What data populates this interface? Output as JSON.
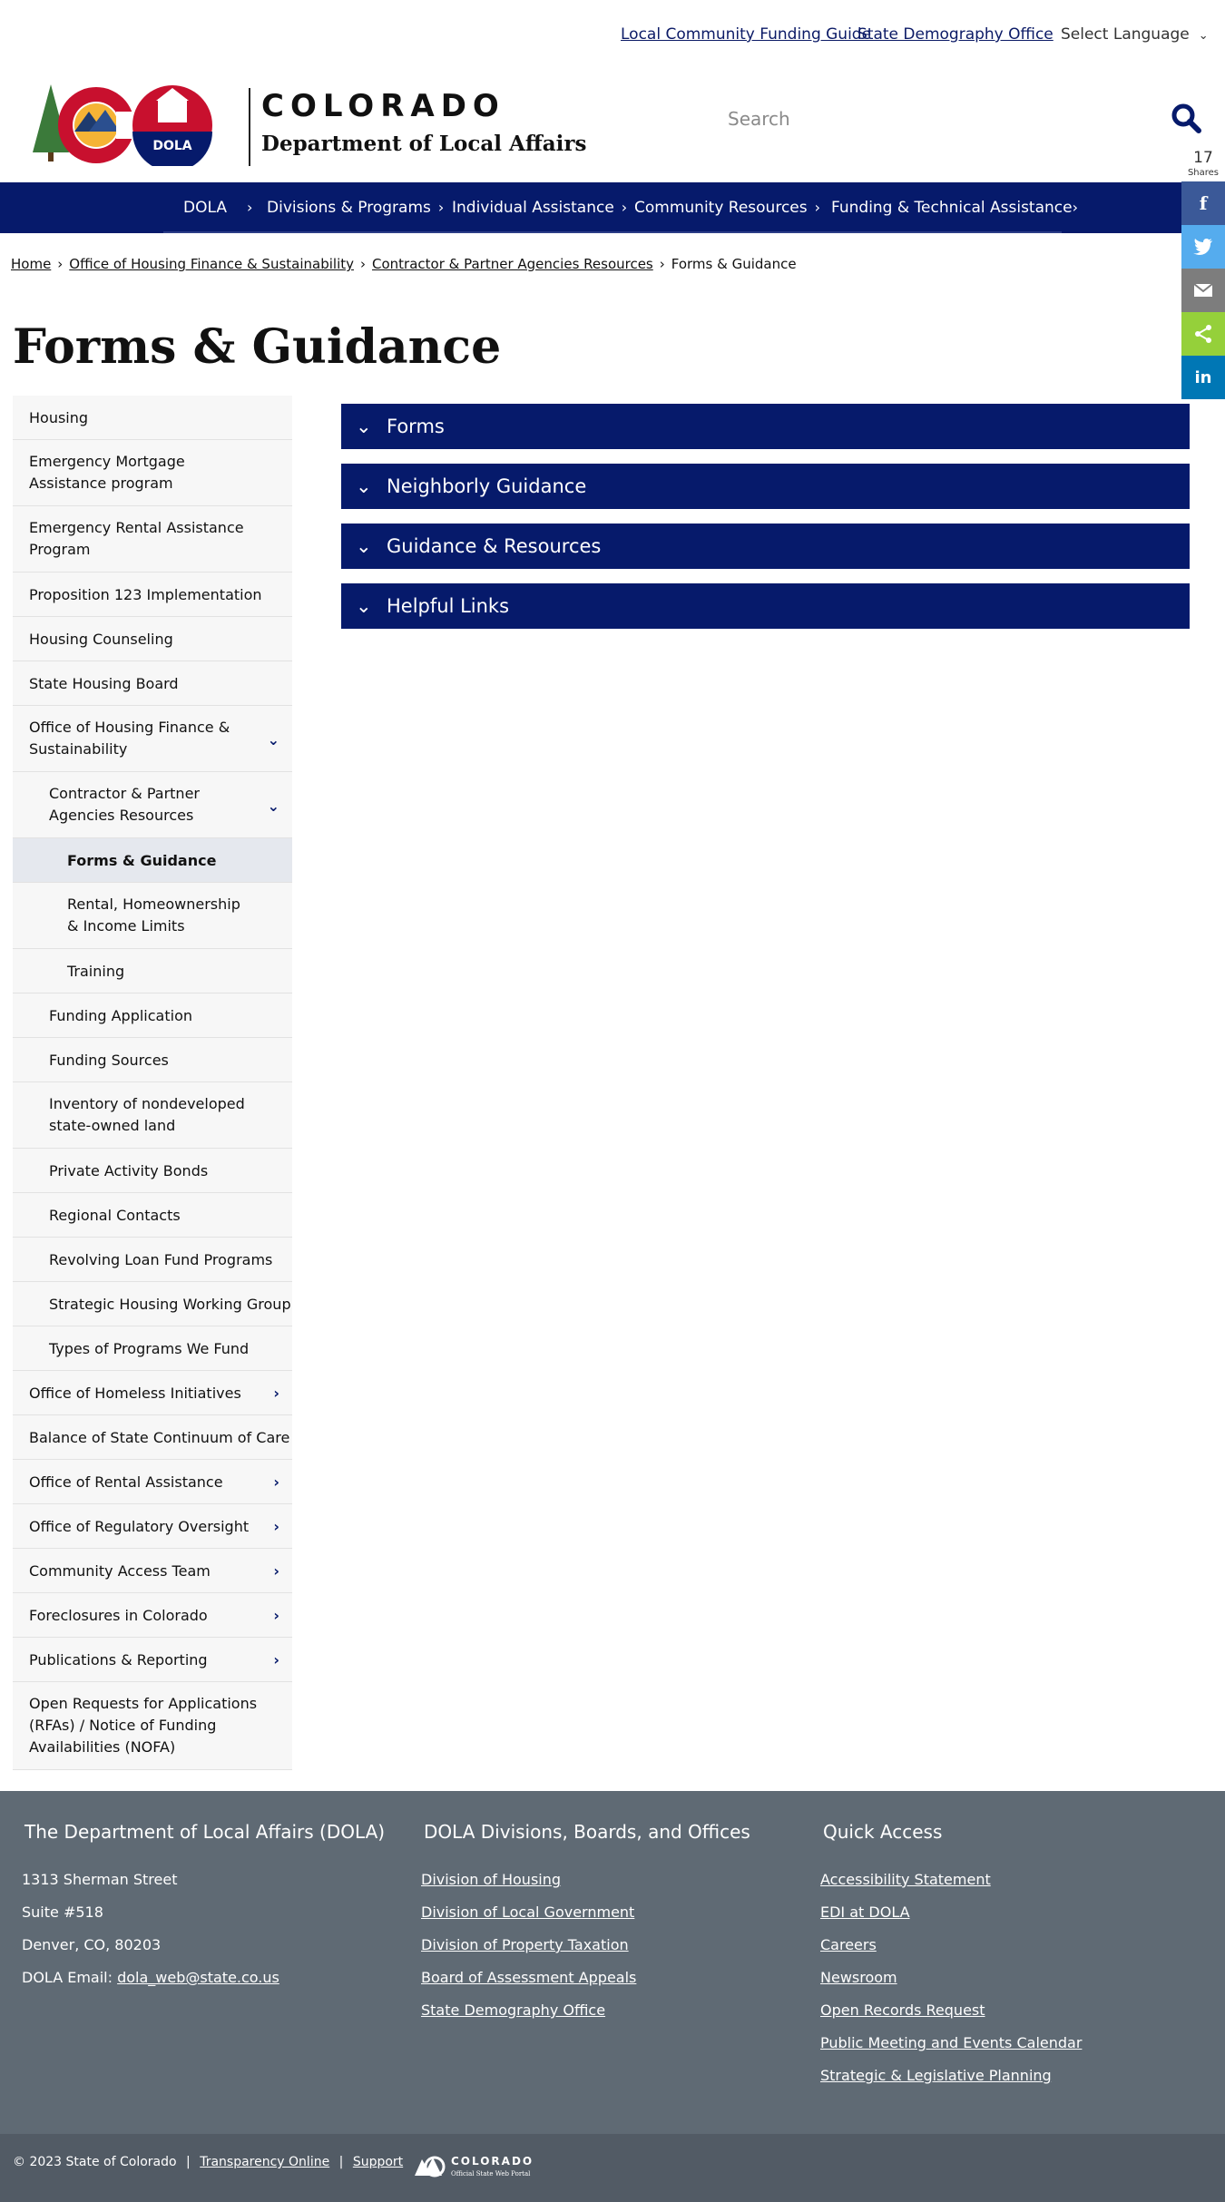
{
  "utility": {
    "link1": "Local Community Funding Guide",
    "link2": "State Demography Office",
    "language": "Select Language"
  },
  "header": {
    "state_word": "COLORADO",
    "department": "Department of Local Affairs",
    "search_placeholder": "Search"
  },
  "nav": {
    "items": [
      "DOLA",
      "Divisions & Programs",
      "Individual Assistance",
      "Community Resources",
      "Funding & Technical Assistance"
    ]
  },
  "share": {
    "count": "17",
    "label": "Shares"
  },
  "breadcrumb": {
    "items": [
      "Home",
      "Office of Housing Finance & Sustainability",
      "Contractor & Partner Agencies Resources"
    ],
    "current": "Forms & Guidance"
  },
  "page_title": "Forms & Guidance",
  "sidebar": {
    "items": [
      "Housing",
      "Emergency Mortgage Assistance program",
      "Emergency Rental Assistance Program",
      "Proposition 123 Implementation",
      "Housing Counseling",
      "State Housing Board",
      "Office of Housing Finance & Sustainability",
      "Contractor & Partner Agencies Resources",
      "Forms & Guidance",
      "Rental, Homeownership & Income Limits",
      "Training",
      "Funding Application",
      "Funding Sources",
      "Inventory of nondeveloped state-owned land",
      "Private Activity Bonds",
      "Regional Contacts",
      "Revolving Loan Fund Programs",
      "Strategic Housing Working Group",
      "Types of Programs We Fund",
      "Office of Homeless Initiatives",
      "Balance of State Continuum of Care",
      "Office of Rental Assistance",
      "Office of Regulatory Oversight",
      "Community Access Team",
      "Foreclosures in Colorado",
      "Publications & Reporting",
      "Open Requests for Applications (RFAs) / Notice of Funding Availabilities (NOFA)"
    ]
  },
  "accordions": [
    "Forms",
    "Neighborly Guidance",
    "Guidance & Resources",
    "Helpful Links"
  ],
  "footer": {
    "col1": {
      "heading": "The Department of Local Affairs (DOLA)",
      "address1": "1313 Sherman Street",
      "address2": "Suite  #518",
      "address3": "Denver, CO, 80203",
      "email_label": "DOLA Email: ",
      "email": "dola_web@state.co.us"
    },
    "col2": {
      "heading": "DOLA Divisions, Boards, and Offices",
      "links": [
        "Division of Housing",
        "Division of Local Government",
        "Division of Property Taxation",
        "Board of Assessment Appeals",
        "State Demography Office"
      ]
    },
    "col3": {
      "heading": "Quick Access",
      "links": [
        "Accessibility Statement",
        "EDI at DOLA",
        "Careers",
        "Newsroom",
        "Open Records Request",
        "Public Meeting and Events Calendar",
        "Strategic & Legislative Planning"
      ]
    },
    "copyright": "© 2023 State of Colorado",
    "sep": "|",
    "transparency": "Transparency Online",
    "support": "Support",
    "logo_word": "COLORADO",
    "logo_sub": "Official State Web Portal"
  },
  "colors": {
    "navy": "#061a6b",
    "footer": "#5f6a74",
    "bottombar": "#525b65",
    "facebook": "#3b5998",
    "twitter": "#55acee",
    "email": "#7d7d7d",
    "sharethis": "#95d03a",
    "linkedin": "#0077b5"
  }
}
